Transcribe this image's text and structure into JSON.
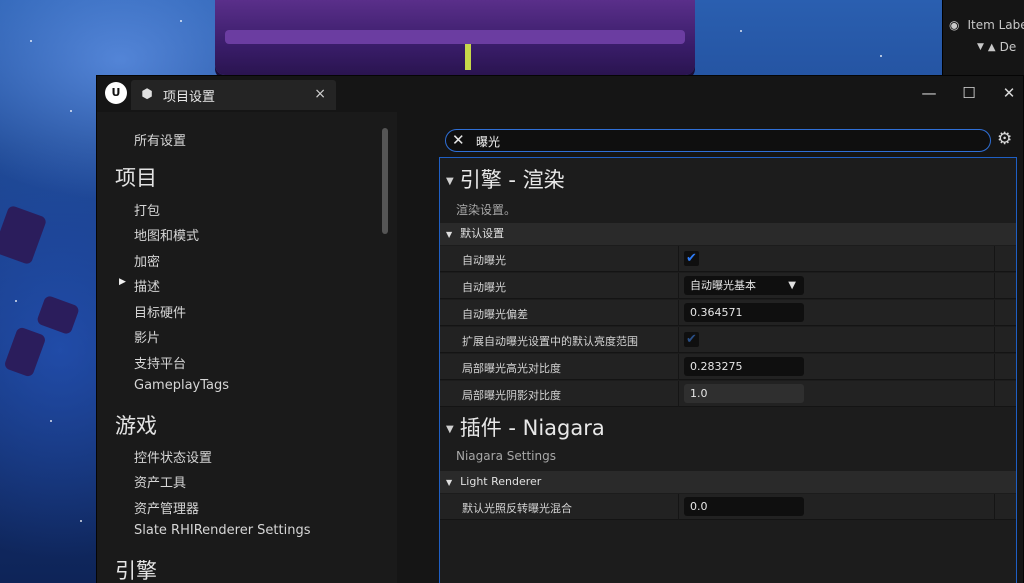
{
  "outliner": {
    "header": "Item Label",
    "row1": "De"
  },
  "window": {
    "tab_title": "项目设置",
    "tab_close": "×",
    "logo": "U",
    "minimize": "—",
    "maximize": "☐",
    "close": "✕"
  },
  "nav": {
    "all_settings": "所有设置",
    "cat_project": "项目",
    "project_items": [
      "打包",
      "地图和模式",
      "加密",
      "描述",
      "目标硬件",
      "影片",
      "支持平台",
      "GameplayTags"
    ],
    "cat_game": "游戏",
    "game_items": [
      "控件状态设置",
      "资产工具",
      "资产管理器",
      "Slate RHIRenderer Settings"
    ],
    "cat_engine": "引擎"
  },
  "search": {
    "value": "曝光"
  },
  "sections": [
    {
      "title": "引擎 - 渲染",
      "desc": "渲染设置。",
      "category": "默认设置",
      "props": [
        {
          "name": "自动曝光",
          "type": "checkbox",
          "checked": true
        },
        {
          "name": "自动曝光",
          "type": "dropdown",
          "value": "自动曝光基本"
        },
        {
          "name": "自动曝光偏差",
          "type": "number",
          "value": "0.364571"
        },
        {
          "name": "扩展自动曝光设置中的默认亮度范围",
          "type": "checkbox",
          "checked": true,
          "disabled": true
        },
        {
          "name": "局部曝光高光对比度",
          "type": "number",
          "value": "0.283275"
        },
        {
          "name": "局部曝光阴影对比度",
          "type": "number",
          "value": "1.0"
        }
      ]
    },
    {
      "title": "插件 - Niagara",
      "desc": "Niagara Settings",
      "category": "Light Renderer",
      "props": [
        {
          "name": "默认光照反转曝光混合",
          "type": "number",
          "value": "0.0"
        }
      ]
    }
  ],
  "colors": {
    "accent": "#2f7cf6",
    "panel_bg": "#1c1c1c",
    "window_bg": "#1a1a1a"
  },
  "icons": {
    "search_clear": "close-icon",
    "gear": "gear-icon",
    "check": "checkmark-icon",
    "eye": "eye-icon"
  }
}
